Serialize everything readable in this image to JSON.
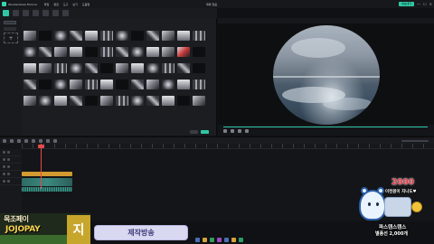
{
  "window": {
    "app_name": "Wondershare Filmora",
    "menu": [
      "파일",
      "편집",
      "도구",
      "보기",
      "도움말"
    ],
    "doc_title": "제목 없음",
    "export_label": "내보내기",
    "controls": [
      "—",
      "☐",
      "✕"
    ]
  },
  "media_panel": {
    "import_icon": "plus-icon",
    "thumbnail_styles": [
      "t0",
      "t1",
      "t2",
      "t3",
      "t4",
      "t5",
      "t2",
      "t1",
      "t3",
      "t0",
      "t4",
      "t5",
      "t2",
      "t3",
      "t0",
      "t4",
      "t1",
      "t5",
      "t3",
      "t2",
      "t4",
      "t0",
      "tred",
      "t1",
      "t4",
      "t0",
      "t5",
      "t2",
      "t3",
      "t1",
      "t0",
      "t4",
      "t2",
      "t5",
      "t3",
      "t1",
      "t3",
      "t1",
      "t2",
      "t0",
      "t5",
      "t4",
      "t1",
      "t3",
      "t0",
      "t2",
      "t4",
      "t5",
      "t0",
      "t2",
      "t4",
      "t3",
      "t1",
      "t0",
      "t5",
      "t2",
      "t3",
      "t4",
      "t1",
      "t0"
    ]
  },
  "preview": {
    "shape": "circle"
  },
  "overlays": {
    "left_text_top": "목조페이",
    "left_text_bottom": "JOJOPAY",
    "left_side_char": "지",
    "streamer_tag": "제작방송"
  },
  "donation": {
    "amount": "2000",
    "message": "이천원이 지나도♥",
    "donor_name": "파스텐스텐스",
    "total": "별풍선 2,000개"
  },
  "colors": {
    "accent": "#2fc7a4",
    "playhead": "#e54b4b",
    "donation_amount": "#e53b4a"
  }
}
